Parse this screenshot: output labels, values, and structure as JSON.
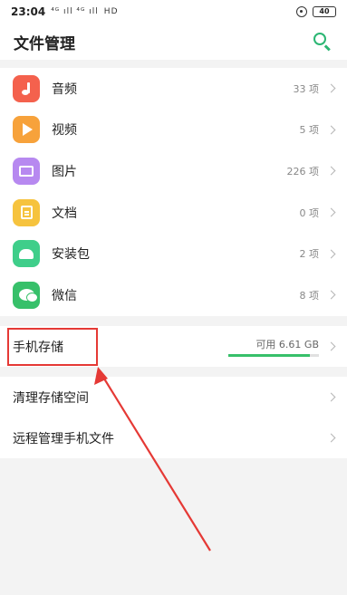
{
  "status_bar": {
    "time": "23:04",
    "signal_text": "⁴ᴳ ıll ⁴ᴳ ıll",
    "network_text": "HD",
    "battery": "40"
  },
  "header": {
    "title": "文件管理",
    "search_icon": "search-icon"
  },
  "categories": [
    {
      "label": "音频",
      "count": "33 项",
      "color": "#f4614d",
      "icon": "music-note-icon"
    },
    {
      "label": "视频",
      "count": "5 项",
      "color": "#f7a23b",
      "icon": "play-icon"
    },
    {
      "label": "图片",
      "count": "226 项",
      "color": "#b789f0",
      "icon": "image-icon"
    },
    {
      "label": "文档",
      "count": "0 项",
      "color": "#f6c33e",
      "icon": "document-icon"
    },
    {
      "label": "安装包",
      "count": "2 项",
      "color": "#3fce8a",
      "icon": "android-icon"
    },
    {
      "label": "微信",
      "count": "8 项",
      "color": "#37c06a",
      "icon": "wechat-icon"
    }
  ],
  "storage": {
    "label": "手机存储",
    "available": "可用 6.61 GB",
    "used_fraction": 0.9,
    "bar_color": "#37c06a"
  },
  "tools": [
    {
      "label": "清理存储空间"
    },
    {
      "label": "远程管理手机文件"
    }
  ],
  "annotation": {
    "color": "#e53935"
  }
}
